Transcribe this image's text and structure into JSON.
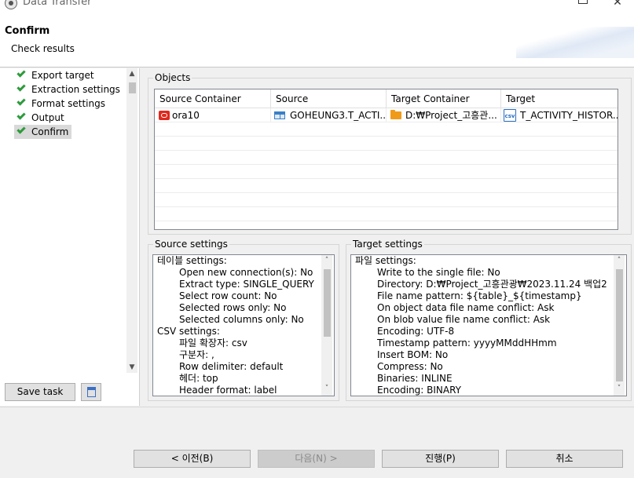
{
  "window": {
    "title": "Data Transfer"
  },
  "header": {
    "title": "Confirm",
    "description": "Check results"
  },
  "nav": {
    "items": [
      {
        "label": "Export target",
        "selected": false
      },
      {
        "label": "Extraction settings",
        "selected": false
      },
      {
        "label": "Format settings",
        "selected": false
      },
      {
        "label": "Output",
        "selected": false
      },
      {
        "label": "Confirm",
        "selected": true
      }
    ]
  },
  "left_buttons": {
    "save_task": "Save task"
  },
  "objects": {
    "title": "Objects",
    "columns": [
      "Source Container",
      "Source",
      "Target Container",
      "Target"
    ],
    "rows": [
      {
        "source_container": "ora10",
        "source": "GOHEUNG3.T_ACTI...",
        "target_container": "D:₩Project_고흥관...",
        "target": "T_ACTIVITY_HISTOR..."
      }
    ]
  },
  "source_settings": {
    "title": "Source settings",
    "lines": [
      {
        "text": "테이블 settings:",
        "indent": false
      },
      {
        "text": "Open new connection(s): No",
        "indent": true
      },
      {
        "text": "Extract type: SINGLE_QUERY",
        "indent": true
      },
      {
        "text": "Select row count: No",
        "indent": true
      },
      {
        "text": "Selected rows only: No",
        "indent": true
      },
      {
        "text": "Selected columns only: No",
        "indent": true
      },
      {
        "text": "CSV settings:",
        "indent": false
      },
      {
        "text": "파일 확장자: csv",
        "indent": true
      },
      {
        "text": "구분자: ,",
        "indent": true
      },
      {
        "text": "Row delimiter: default",
        "indent": true
      },
      {
        "text": "헤더: top",
        "indent": true
      },
      {
        "text": "Header format: label",
        "indent": true
      }
    ]
  },
  "target_settings": {
    "title": "Target settings",
    "lines": [
      {
        "text": "파일 settings:",
        "indent": false
      },
      {
        "text": "Write to the single file: No",
        "indent": true
      },
      {
        "text": "Directory: D:₩Project_고흥관광₩2023.11.24 백업2",
        "indent": true
      },
      {
        "text": "File name pattern: ${table}_${timestamp}",
        "indent": true
      },
      {
        "text": "On object data file name conflict: Ask",
        "indent": true
      },
      {
        "text": "On blob value file name conflict: Ask",
        "indent": true
      },
      {
        "text": "Encoding: UTF-8",
        "indent": true
      },
      {
        "text": "Timestamp pattern: yyyyMMddHHmm",
        "indent": true
      },
      {
        "text": "Insert BOM: No",
        "indent": true
      },
      {
        "text": "Compress: No",
        "indent": true
      },
      {
        "text": "Binaries: INLINE",
        "indent": true
      },
      {
        "text": "Encoding: BINARY",
        "indent": true
      }
    ]
  },
  "footer": {
    "back": "< 이전(B)",
    "next": "다음(N) >",
    "proceed": "진행(P)",
    "cancel": "취소"
  }
}
